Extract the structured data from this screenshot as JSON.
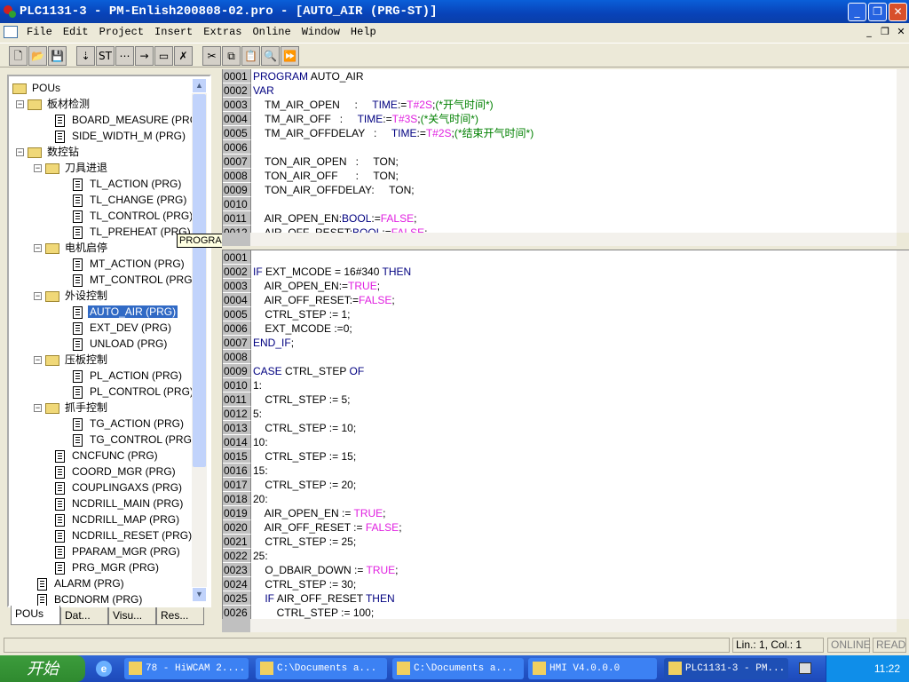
{
  "window": {
    "title": "PLC1131-3 - PM-Enlish200808-02.pro - [AUTO_AIR (PRG-ST)]",
    "minimize": "_",
    "restore": "❐",
    "close": "✕"
  },
  "menu": [
    "File",
    "Edit",
    "Project",
    "Insert",
    "Extras",
    "Online",
    "Window",
    "Help"
  ],
  "mdi_controls": [
    "_",
    "❐",
    "✕"
  ],
  "toolbar": [
    {
      "name": "new-icon",
      "glyph": "🗋"
    },
    {
      "name": "open-icon",
      "glyph": "📂"
    },
    {
      "name": "save-icon",
      "glyph": "💾"
    },
    {
      "name": "download-icon",
      "glyph": "⇣"
    },
    {
      "name": "stop-icon",
      "glyph": "ST"
    },
    {
      "name": "step-icon",
      "glyph": "⋯"
    },
    {
      "name": "step-in-icon",
      "glyph": "→"
    },
    {
      "name": "login-icon",
      "glyph": "▭"
    },
    {
      "name": "logout-icon",
      "glyph": "✗"
    },
    {
      "name": "cut-icon",
      "glyph": "✂"
    },
    {
      "name": "copy-icon",
      "glyph": "⧉"
    },
    {
      "name": "paste-icon",
      "glyph": "📋"
    },
    {
      "name": "find-icon",
      "glyph": "🔍"
    },
    {
      "name": "find-next-icon",
      "glyph": "⏩"
    }
  ],
  "tree": [
    {
      "depth": 0,
      "type": "folder",
      "label": "POUs"
    },
    {
      "depth": 1,
      "type": "folder",
      "label": "板材检测",
      "expanded": true
    },
    {
      "depth": 2,
      "type": "doc",
      "label": "BOARD_MEASURE (PRG)"
    },
    {
      "depth": 2,
      "type": "doc",
      "label": "SIDE_WIDTH_M (PRG)"
    },
    {
      "depth": 1,
      "type": "folder",
      "label": "数控钻",
      "expanded": true
    },
    {
      "depth": 2,
      "type": "folder",
      "label": "刀具进退",
      "expanded": true
    },
    {
      "depth": 3,
      "type": "doc",
      "label": "TL_ACTION (PRG)"
    },
    {
      "depth": 3,
      "type": "doc",
      "label": "TL_CHANGE (PRG)"
    },
    {
      "depth": 3,
      "type": "doc",
      "label": "TL_CONTROL (PRG)"
    },
    {
      "depth": 3,
      "type": "doc",
      "label": "TL_PREHEAT (PRG)"
    },
    {
      "depth": 2,
      "type": "folder",
      "label": "电机启停",
      "expanded": true
    },
    {
      "depth": 3,
      "type": "doc",
      "label": "MT_ACTION (PRG)"
    },
    {
      "depth": 3,
      "type": "doc",
      "label": "MT_CONTROL (PRG)"
    },
    {
      "depth": 2,
      "type": "folder",
      "label": "外设控制",
      "expanded": true
    },
    {
      "depth": 3,
      "type": "doc",
      "label": "AUTO_AIR (PRG)",
      "selected": true
    },
    {
      "depth": 3,
      "type": "doc",
      "label": "EXT_DEV (PRG)"
    },
    {
      "depth": 3,
      "type": "doc",
      "label": "UNLOAD (PRG)"
    },
    {
      "depth": 2,
      "type": "folder",
      "label": "压板控制",
      "expanded": true
    },
    {
      "depth": 3,
      "type": "doc",
      "label": "PL_ACTION (PRG)"
    },
    {
      "depth": 3,
      "type": "doc",
      "label": "PL_CONTROL (PRG)"
    },
    {
      "depth": 2,
      "type": "folder",
      "label": "抓手控制",
      "expanded": true
    },
    {
      "depth": 3,
      "type": "doc",
      "label": "TG_ACTION (PRG)"
    },
    {
      "depth": 3,
      "type": "doc",
      "label": "TG_CONTROL (PRG)"
    },
    {
      "depth": 2,
      "type": "doc",
      "label": "CNCFUNC (PRG)"
    },
    {
      "depth": 2,
      "type": "doc",
      "label": "COORD_MGR (PRG)"
    },
    {
      "depth": 2,
      "type": "doc",
      "label": "COUPLINGAXS (PRG)"
    },
    {
      "depth": 2,
      "type": "doc",
      "label": "NCDRILL_MAIN (PRG)"
    },
    {
      "depth": 2,
      "type": "doc",
      "label": "NCDRILL_MAP (PRG)"
    },
    {
      "depth": 2,
      "type": "doc",
      "label": "NCDRILL_RESET (PRG)"
    },
    {
      "depth": 2,
      "type": "doc",
      "label": "PPARAM_MGR (PRG)"
    },
    {
      "depth": 2,
      "type": "doc",
      "label": "PRG_MGR (PRG)"
    },
    {
      "depth": 1,
      "type": "doc",
      "label": "ALARM (PRG)"
    },
    {
      "depth": 1,
      "type": "doc",
      "label": "BCDNORM (PRG)"
    }
  ],
  "tooltip": "PROGRAM",
  "left_tabs": [
    "POUs",
    "Dat...",
    "Visu...",
    "Res..."
  ],
  "declaration": [
    [
      "0001",
      [
        [
          "kw",
          "PROGRAM "
        ],
        [
          "pl",
          "AUTO_AIR"
        ]
      ]
    ],
    [
      "0002",
      [
        [
          "kw",
          "VAR"
        ]
      ]
    ],
    [
      "0003",
      [
        [
          "pl",
          "    TM_AIR_OPEN     :     "
        ],
        [
          "kw",
          "TIME"
        ],
        [
          "pl",
          ":="
        ],
        [
          "lit",
          "T#2S"
        ],
        [
          "pl",
          ";"
        ],
        [
          "cm",
          "(*开气时间*)"
        ]
      ]
    ],
    [
      "0004",
      [
        [
          "pl",
          "    TM_AIR_OFF   :     "
        ],
        [
          "kw",
          "TIME"
        ],
        [
          "pl",
          ":="
        ],
        [
          "lit",
          "T#3S"
        ],
        [
          "pl",
          ";"
        ],
        [
          "cm",
          "(*关气时间*)"
        ]
      ]
    ],
    [
      "0005",
      [
        [
          "pl",
          "    TM_AIR_OFFDELAY   :     "
        ],
        [
          "kw",
          "TIME"
        ],
        [
          "pl",
          ":="
        ],
        [
          "lit",
          "T#2S"
        ],
        [
          "pl",
          ";"
        ],
        [
          "cm",
          "(*结束开气时间*)"
        ]
      ]
    ],
    [
      "0006",
      []
    ],
    [
      "0007",
      [
        [
          "pl",
          "    TON_AIR_OPEN   :     TON;"
        ]
      ]
    ],
    [
      "0008",
      [
        [
          "pl",
          "    TON_AIR_OFF      :     TON;"
        ]
      ]
    ],
    [
      "0009",
      [
        [
          "pl",
          "    TON_AIR_OFFDELAY:     TON;"
        ]
      ]
    ],
    [
      "0010",
      []
    ],
    [
      "0011",
      [
        [
          "pl",
          "    AIR_OPEN_EN:"
        ],
        [
          "kw",
          "BOOL"
        ],
        [
          "pl",
          ":="
        ],
        [
          "lit",
          "FALSE"
        ],
        [
          "pl",
          ";"
        ]
      ]
    ],
    [
      "0012",
      [
        [
          "pl",
          "    AIR_OFF_RESET:"
        ],
        [
          "kw",
          "BOOL"
        ],
        [
          "pl",
          ":="
        ],
        [
          "lit",
          "FALSE"
        ],
        [
          "pl",
          ";"
        ]
      ]
    ]
  ],
  "body": [
    [
      "0001",
      []
    ],
    [
      "0002",
      [
        [
          "kw",
          "IF "
        ],
        [
          "pl",
          "EXT_MCODE = 16#340 "
        ],
        [
          "kw",
          "THEN"
        ]
      ]
    ],
    [
      "0003",
      [
        [
          "pl",
          "    AIR_OPEN_EN:="
        ],
        [
          "lit",
          "TRUE"
        ],
        [
          "pl",
          ";"
        ]
      ]
    ],
    [
      "0004",
      [
        [
          "pl",
          "    AIR_OFF_RESET:="
        ],
        [
          "lit",
          "FALSE"
        ],
        [
          "pl",
          ";"
        ]
      ]
    ],
    [
      "0005",
      [
        [
          "pl",
          "    CTRL_STEP := 1;"
        ]
      ]
    ],
    [
      "0006",
      [
        [
          "pl",
          "    EXT_MCODE :=0;"
        ]
      ]
    ],
    [
      "0007",
      [
        [
          "kw",
          "END_IF"
        ],
        [
          "pl",
          ";"
        ]
      ]
    ],
    [
      "0008",
      []
    ],
    [
      "0009",
      [
        [
          "kw",
          "CASE "
        ],
        [
          "pl",
          "CTRL_STEP "
        ],
        [
          "kw",
          "OF"
        ]
      ]
    ],
    [
      "0010",
      [
        [
          "pl",
          "1:"
        ]
      ]
    ],
    [
      "0011",
      [
        [
          "pl",
          "    CTRL_STEP := 5;"
        ]
      ]
    ],
    [
      "0012",
      [
        [
          "pl",
          "5:"
        ]
      ]
    ],
    [
      "0013",
      [
        [
          "pl",
          "    CTRL_STEP := 10;"
        ]
      ]
    ],
    [
      "0014",
      [
        [
          "pl",
          "10:"
        ]
      ]
    ],
    [
      "0015",
      [
        [
          "pl",
          "    CTRL_STEP := 15;"
        ]
      ]
    ],
    [
      "0016",
      [
        [
          "pl",
          "15:"
        ]
      ]
    ],
    [
      "0017",
      [
        [
          "pl",
          "    CTRL_STEP := 20;"
        ]
      ]
    ],
    [
      "0018",
      [
        [
          "pl",
          "20:"
        ]
      ]
    ],
    [
      "0019",
      [
        [
          "pl",
          "    AIR_OPEN_EN := "
        ],
        [
          "lit",
          "TRUE"
        ],
        [
          "pl",
          ";"
        ]
      ]
    ],
    [
      "0020",
      [
        [
          "pl",
          "    AIR_OFF_RESET := "
        ],
        [
          "lit",
          "FALSE"
        ],
        [
          "pl",
          ";"
        ]
      ]
    ],
    [
      "0021",
      [
        [
          "pl",
          "    CTRL_STEP := 25;"
        ]
      ]
    ],
    [
      "0022",
      [
        [
          "pl",
          "25:"
        ]
      ]
    ],
    [
      "0023",
      [
        [
          "pl",
          "    O_DBAIR_DOWN := "
        ],
        [
          "lit",
          "TRUE"
        ],
        [
          "pl",
          ";"
        ]
      ]
    ],
    [
      "0024",
      [
        [
          "pl",
          "    CTRL_STEP := 30;"
        ]
      ]
    ],
    [
      "0025",
      [
        [
          "pl",
          "    "
        ],
        [
          "kw",
          "IF "
        ],
        [
          "pl",
          "AIR_OFF_RESET "
        ],
        [
          "kw",
          "THEN"
        ]
      ]
    ],
    [
      "0026",
      [
        [
          "pl",
          "        CTRL_STEP := 100;"
        ]
      ]
    ]
  ],
  "status": {
    "position": "Lin.: 1, Col.: 1",
    "online": "ONLINE",
    "read": "READ"
  },
  "taskbar": {
    "start": "开始",
    "tasks": [
      "78 - HiWCAM 2....",
      "C:\\Documents a...",
      "C:\\Documents a...",
      "HMI V4.0.0.0",
      "PLC1131-3 - PM..."
    ],
    "active_task": 4,
    "clock": "11:22"
  },
  "colors": {
    "keyword": "#000080",
    "literal": "#e020e0",
    "comment": "#008000",
    "selection": "#316ac5",
    "titlebar": "#0842b8"
  }
}
